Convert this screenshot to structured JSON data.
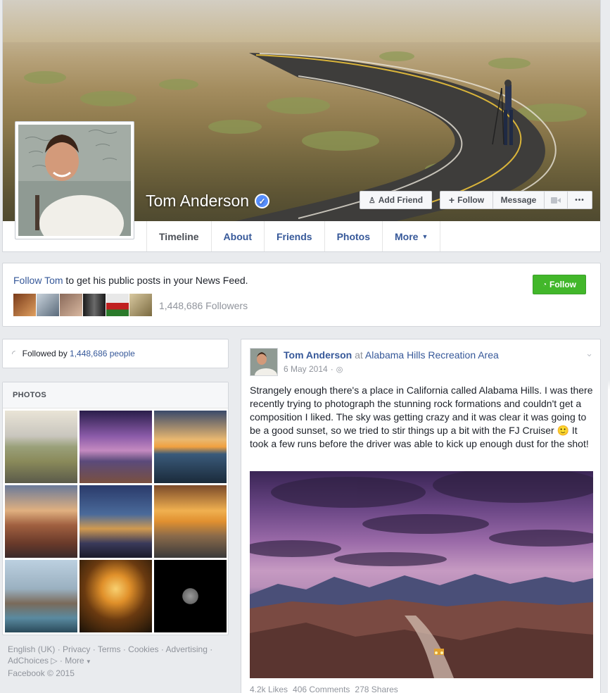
{
  "profile": {
    "name": "Tom Anderson",
    "verified_mark": "✓"
  },
  "cover_buttons": {
    "add_friend": "Add Friend",
    "follow": "Follow",
    "message": "Message",
    "more": "•••"
  },
  "tabs": [
    {
      "label": "Timeline"
    },
    {
      "label": "About"
    },
    {
      "label": "Friends"
    },
    {
      "label": "Photos"
    },
    {
      "label": "More"
    }
  ],
  "follow_box": {
    "link": "Follow Tom",
    "rest": " to get his public posts in your News Feed.",
    "followers": "1,448,686 Followers",
    "button": "Follow"
  },
  "followed_by": {
    "prefix": "Followed by ",
    "link": "1,448,686 people"
  },
  "photos": {
    "title": "PHOTOS"
  },
  "footer": {
    "links": [
      "English (UK)",
      "Privacy",
      "Terms",
      "Cookies",
      "Advertising",
      "AdChoices",
      "More"
    ],
    "copyright": "Facebook © 2015"
  },
  "post": {
    "author": "Tom Anderson",
    "at": " at ",
    "place": "Alabama Hills Recreation Area",
    "date": "6 May 2014",
    "text": "Strangely enough there's a place in California called Alabama Hills. I was there recently trying to photograph the stunning rock formations and couldn't get a composition I liked. The sky was getting crazy and it was clear it was going to be a good sunset, so we tried to stir things up a bit with the FJ Cruiser 🙂 It took a few runs before the driver was able to kick up enough dust for the shot!",
    "likes": "4.2k Likes",
    "comments": "406 Comments",
    "shares": "278 Shares"
  },
  "colors": {
    "link_blue": "#365899",
    "green": "#42b72a",
    "verified": "#5890ff"
  }
}
